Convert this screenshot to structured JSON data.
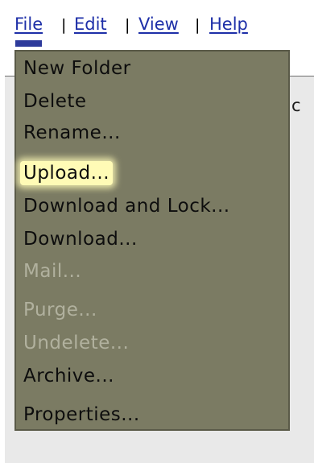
{
  "menubar": {
    "items": [
      "File",
      "Edit",
      "View",
      "Help"
    ],
    "separator": "|"
  },
  "background": {
    "partial_text": "c"
  },
  "menu": {
    "items": [
      {
        "label": "New Folder",
        "enabled": true
      },
      {
        "label": "Delete",
        "enabled": true
      },
      {
        "label": "Rename...",
        "enabled": true
      },
      {
        "label": "Upload...",
        "enabled": true,
        "highlighted": true
      },
      {
        "label": "Download and Lock...",
        "enabled": true
      },
      {
        "label": "Download...",
        "enabled": true
      },
      {
        "label": "Mail...",
        "enabled": false
      },
      {
        "label": "Purge...",
        "enabled": false
      },
      {
        "label": "Undelete...",
        "enabled": false
      },
      {
        "label": "Archive...",
        "enabled": true
      },
      {
        "label": "Properties...",
        "enabled": true
      }
    ]
  },
  "colors": {
    "menu_background": "#7b7b63",
    "menu_text": "#0d0d0d",
    "disabled_text": "#b1b19e",
    "highlight": "#fffbb6",
    "menubar_link": "#1e2fa8"
  }
}
